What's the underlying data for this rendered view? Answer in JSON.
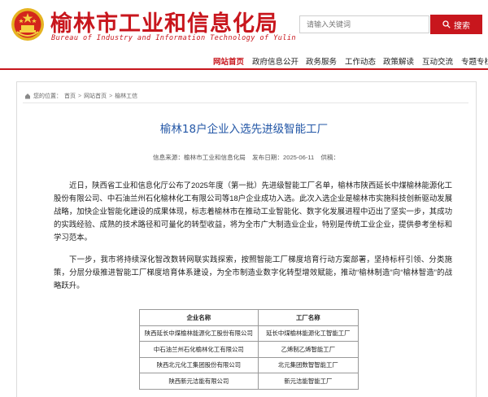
{
  "header": {
    "title": "榆林市工业和信息化局",
    "subtitle": "Bureau of Industry and Information Technology of Yulin",
    "emblem_icon": "national-emblem-icon",
    "search": {
      "placeholder": "请输入关键词",
      "button_label": "搜索",
      "button_icon": "search-icon"
    },
    "brand_color": "#c8161d"
  },
  "nav": {
    "items": [
      "网站首页",
      "政府信息公开",
      "政务服务",
      "工作动态",
      "政策解读",
      "互动交流",
      "专题专栏"
    ],
    "active_index": 0
  },
  "breadcrumb": {
    "prefix": "您的位置：",
    "home_icon": "home-icon",
    "items": [
      "首页",
      "网站首页",
      "榆林工信"
    ],
    "separator": ">"
  },
  "article": {
    "title": "榆林18户企业入选先进级智能工厂",
    "source": "信息来源：榆林市工业和信息化局",
    "date": "发布日期：2025-06-11",
    "contributor": "供稿：",
    "paragraphs": [
      "近日，陕西省工业和信息化厅公布了2025年度（第一批）先进级智能工厂名单，榆林市陕西延长中煤榆林能源化工股份有限公司、中石油兰州石化榆林化工有限公司等18户企业成功入选。此次入选企业是榆林市实施科技创新驱动发展战略，加快企业智能化建设的成果体现，标志着榆林市在推动工业智能化、数字化发展进程中迈出了坚实一步，其成功的实践经验、成熟的技术路径和可量化的转型收益，将为全市广大制造业企业，特别是传统工业企业，提供参考坐标和学习范本。",
      "下一步，我市将持续深化智改数转网联实践探索，按照智能工厂梯度培育行动方案部署，坚持标杆引领、分类施策，分层分级推进智能工厂梯度培育体系建设，为全市制造业数字化转型增效赋能，推动“榆林制造”向“榆林智造”的战略跃升。"
    ]
  },
  "table": {
    "headers": [
      "企业名称",
      "工厂名称"
    ],
    "rows": [
      [
        "陕西延长中煤榆林能源化工股份有限公司",
        "延长中煤榆林能源化工智能工厂"
      ],
      [
        "中石油兰州石化榆林化工有限公司",
        "乙烯制乙烯智能工厂"
      ],
      [
        "陕西北元化工集团股份有限公司",
        "北元集团数智智能工厂"
      ],
      [
        "陕西新元洁能有限公司",
        "新元洁能智能工厂"
      ]
    ]
  }
}
